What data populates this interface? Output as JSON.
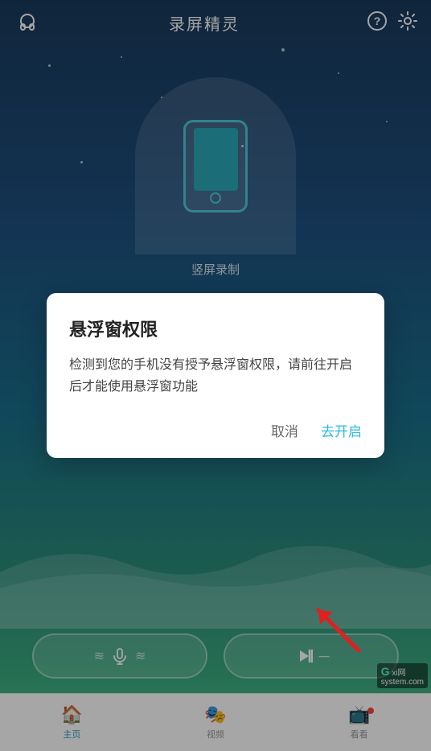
{
  "app": {
    "title": "录屏精灵",
    "bg_color_top": "#1a3a5c",
    "bg_color_bottom": "#4ec89a"
  },
  "header": {
    "title": "录屏精灵",
    "left_icon": "headphone-icon",
    "right_icons": [
      "help-icon",
      "settings-icon"
    ]
  },
  "phone_card": {
    "label": "竖屏录制"
  },
  "action_buttons": [
    {
      "id": "audio-btn",
      "icon": "🎙",
      "label": "audio-record-button"
    },
    {
      "id": "video-btn",
      "icon": "▶",
      "label": "video-record-button"
    }
  ],
  "bottom_nav": {
    "items": [
      {
        "id": "home",
        "label": "主页",
        "icon": "🏠",
        "active": true
      },
      {
        "id": "video",
        "label": "视频",
        "icon": "🎭",
        "active": false
      },
      {
        "id": "watch",
        "label": "看看",
        "icon": "📺",
        "active": false,
        "badge": true
      }
    ]
  },
  "dialog": {
    "title": "悬浮窗权限",
    "body": "检测到您的手机没有授予悬浮窗权限，请前往开启后才能使用悬浮窗功能",
    "cancel_label": "取消",
    "confirm_label": "去开启"
  },
  "watermark": {
    "prefix": "G",
    "text": "xi网",
    "sub": "system.com"
  }
}
